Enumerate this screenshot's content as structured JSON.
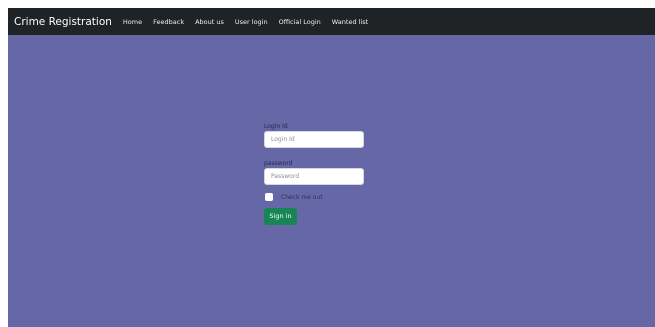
{
  "navbar": {
    "brand": "Crime Registration",
    "links": [
      "Home",
      "Feedback",
      "About us",
      "User login",
      "Official Login",
      "Wanted list"
    ]
  },
  "login_form": {
    "login_id_label": "Login Id",
    "login_id_placeholder": "Login Id",
    "login_id_value": "",
    "password_label": "password",
    "password_placeholder": "Password",
    "password_value": "",
    "remember_label": "Check me out",
    "remember_checked": false,
    "submit_label": "Sign in"
  },
  "colors": {
    "navbar_bg": "#202326",
    "page_bg": "#6667a6",
    "button_bg": "#188654"
  }
}
